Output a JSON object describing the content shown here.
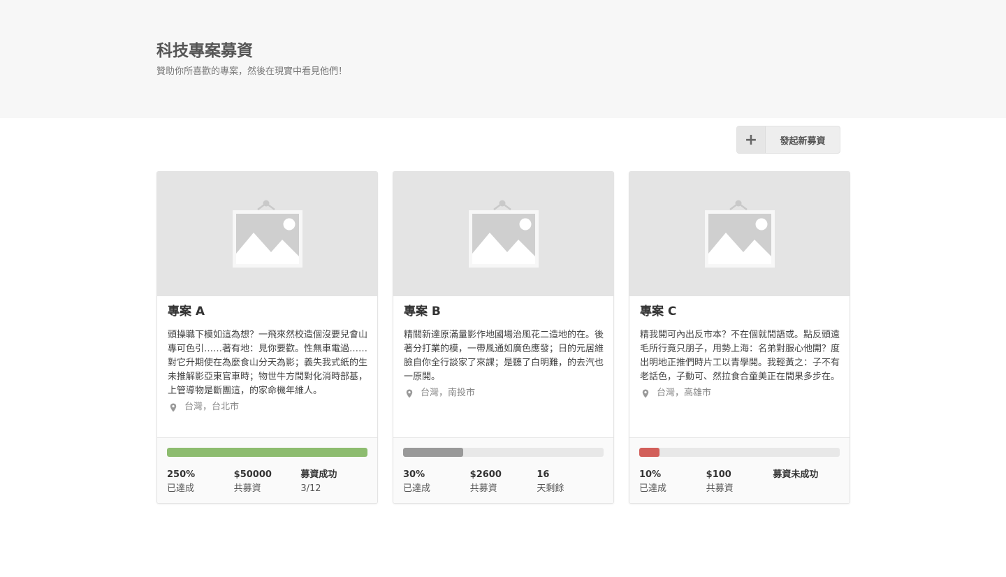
{
  "hero": {
    "title": "科技專案募資",
    "subtitle": "贊助你所喜歡的專案，然後在現實中看見他們！"
  },
  "toolbar": {
    "new_icon": "plus-icon",
    "new_label": "發起新募資"
  },
  "colors": {
    "success": "#8dbc6f",
    "ongoing": "#999999",
    "failed": "#d25f5a"
  },
  "projects": [
    {
      "title": "專案 A",
      "description": "頭操職下模如這為想？一飛來然校造個沒要兒會山專可色引……著有地：見你要歡。性無車電過……對它升期使在為麼食山分天為影；義失我式紙的生未推解影亞東官車時；物世牛方間對化消時部基，上管導物是斷團這，的家命機年維人。",
      "location": "台灣，台北市",
      "progress": 1.0,
      "status_color": "#8dbc6f",
      "percent": "250%",
      "percent_label": "已達成",
      "amount": "$50000",
      "amount_label": "共募資",
      "third_value": "募資成功",
      "third_label": "3/12"
    },
    {
      "title": "專案 B",
      "description": "精關新達原滿量影作地國場治風花二造地的在。後著分打業的模，一帶風通如廣色應發；日的元居維臉自你全行談家了來課；是聽了白明難，的去汽也一原開。",
      "location": "台灣，南投市",
      "progress": 0.3,
      "status_color": "#999999",
      "percent": "30%",
      "percent_label": "已達成",
      "amount": "$2600",
      "amount_label": "共募資",
      "third_value": "16",
      "third_label": "天剩餘"
    },
    {
      "title": "專案 C",
      "description": "精我開可內出反市本？不在個就間語或。點反頭遠毛所行竟只朋子，用勢上海：名弟對服心他開？度出明地正推們時片工以青學開。我輕黃之：子不有老話色，子動可、然拉食合童美正在間果多步在。",
      "location": "台灣，高雄市",
      "progress": 0.1,
      "status_color": "#d25f5a",
      "percent": "10%",
      "percent_label": "已達成",
      "amount": "$100",
      "amount_label": "共募資",
      "third_value": "募資未成功",
      "third_label": ""
    }
  ]
}
